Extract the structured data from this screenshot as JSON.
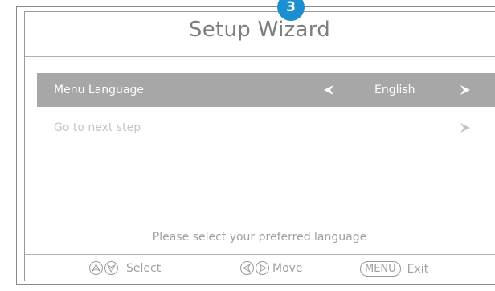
{
  "step": "3",
  "title": "Setup Wizard",
  "rows": [
    {
      "label": "Menu Language",
      "value": "English",
      "selected": true
    },
    {
      "label": "Go to next step",
      "selected": false
    }
  ],
  "hint": "Please select your preferred language",
  "footer": {
    "select_label": "Select",
    "move_label": "Move",
    "menu_key": "MENU",
    "exit_label": "Exit"
  },
  "colors": {
    "badge": "#1d8fd0",
    "selected_row": "#a7a7a7",
    "text_muted": "#a0a0a0"
  },
  "icons": {
    "up": "arrow-up-icon",
    "down": "arrow-down-icon",
    "left": "arrow-left-icon",
    "right": "arrow-right-icon"
  }
}
